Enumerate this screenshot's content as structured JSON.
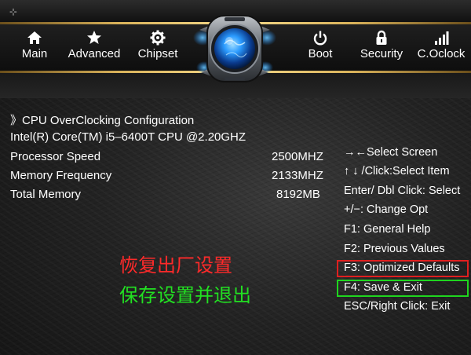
{
  "nav": {
    "items": [
      {
        "label": "Main",
        "icon": "home-icon"
      },
      {
        "label": "Advanced",
        "icon": "star-icon"
      },
      {
        "label": "Chipset",
        "icon": "gear-icon"
      },
      {
        "label": "Boot",
        "icon": "power-icon"
      },
      {
        "label": "Security",
        "icon": "lock-icon"
      },
      {
        "label": "C.Oclock",
        "icon": "bar-chart-icon"
      }
    ]
  },
  "header": {
    "cursor_glyph": "⊹"
  },
  "main": {
    "section_title": "》CPU OverClocking Configuration",
    "cpu_name": "Intel(R) Core(TM) i5–6400T CPU @2.20GHZ",
    "rows": [
      {
        "label": "Processor Speed",
        "value": "2500MHZ"
      },
      {
        "label": "Memory Frequency",
        "value": "2133MHZ"
      },
      {
        "label": "Total Memory",
        "value": "8192MB"
      }
    ]
  },
  "help": {
    "items": [
      "→←Select Screen",
      "↑ ↓ /Click:Select Item",
      "Enter/ Dbl Click: Select",
      "+/−: Change Opt",
      "F1: General Help",
      "F2: Previous Values",
      "F3: Optimized Defaults",
      "F4: Save & Exit",
      "ESC/Right Click: Exit"
    ]
  },
  "annotations": {
    "restore_defaults": "恢复出厂设置",
    "save_exit": "保存设置并退出"
  },
  "colors": {
    "accent_gold": "#d9b25a",
    "highlight_red": "#e01f1f",
    "highlight_green": "#1fd51f",
    "emblem_blue": "#1e8fff"
  }
}
